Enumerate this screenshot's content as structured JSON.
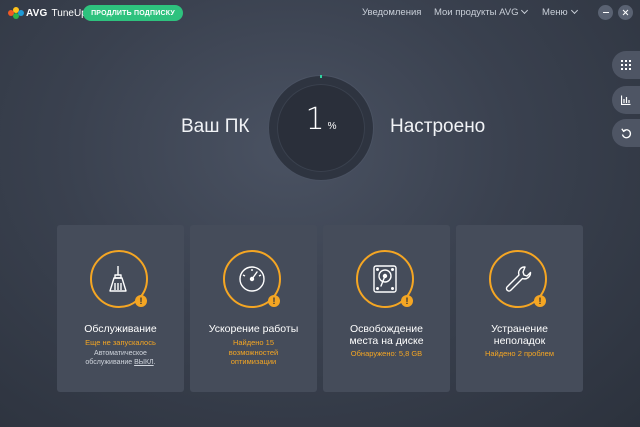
{
  "app": {
    "brand": "AVG",
    "product": "TuneUp"
  },
  "header": {
    "subscribe_label": "ПРОДЛИТЬ ПОДПИСКУ",
    "nav": {
      "notifications": "Уведомления",
      "products": "Мои продукты AVG",
      "menu": "Меню"
    }
  },
  "status": {
    "left_label": "Ваш ПК",
    "value": "1",
    "unit": "%",
    "right_label": "Настроено"
  },
  "cards": [
    {
      "title": "Обслуживание",
      "sub": "Еще не запускалось",
      "note_line1": "Автоматическое",
      "note_prefix": "обслуживание ",
      "note_link": "ВЫКЛ",
      "note_suffix": "."
    },
    {
      "title": "Ускорение работы",
      "sub_line1": "Найдено 15",
      "sub_line2": "возможностей",
      "sub_line3": "оптимизации"
    },
    {
      "title_line1": "Освобождение",
      "title_line2": "места на диске",
      "sub": "Обнаружено: 5,8 GB"
    },
    {
      "title_line1": "Устранение",
      "title_line2": "неполадок",
      "sub": "Найдено 2 проблем"
    }
  ],
  "icons": {
    "maintenance": "broom-icon",
    "speedup": "speedometer-icon",
    "disk": "hard-disk-icon",
    "troubleshoot": "wrench-icon",
    "warning": "warning-icon",
    "apps": "grid-icon",
    "stats": "bar-chart-icon",
    "undo": "undo-icon"
  },
  "colors": {
    "accent": "#2ec27e",
    "warning": "#f5a623",
    "background": "#3a414f",
    "card": "#454c5a"
  }
}
